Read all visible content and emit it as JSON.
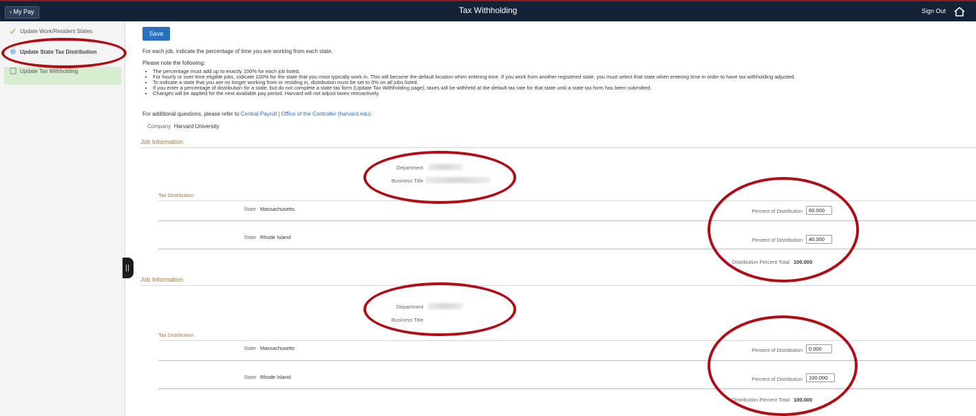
{
  "header": {
    "back_label": "My Pay",
    "title": "Tax Withholding",
    "sign_out": "Sign Out",
    "home_icon": "home-icon"
  },
  "sidebar": {
    "items": [
      {
        "label": "Update Work/Resident States",
        "icon": "pencil-check-icon"
      },
      {
        "label": "Update State Tax Distribution",
        "icon": "percent-icon",
        "active": true
      },
      {
        "label": "Update Tax Withholding",
        "icon": "form-icon"
      }
    ]
  },
  "toolbar": {
    "save_label": "Save"
  },
  "intro": {
    "instruction": "For each job, indicate the percentage of time you are working from each state.",
    "note_heading": "Please note the following:",
    "notes": [
      "The percentage must add up to exactly 100% for each job listed.",
      "For hourly or over-time eligible jobs, indicate 100% for the state that you most typically work in. This will become the default location when entering time. If you work from another registered state, you must select that state when entering time in order to have tax withholding adjusted.",
      "To indicate a state that you are no longer working from or residing in, distribution must be set to 0% on all jobs listed.",
      "If you enter a percentage of distribution for a state, but do not complete a state tax form (Update Tax Withholding page), taxes will be withheld at the default tax rate for that state until a state tax form has been submitted.",
      "Changes will be applied for the next available pay period. Harvard will not adjust taxes retroactively."
    ],
    "additional_prefix": "For additional questions, please refer to",
    "additional_link": "Central Payroll | Office of the Controller (harvard.edu).",
    "company_label": "Company",
    "company_value": "Harvard University"
  },
  "labels": {
    "job_information": "Job Information",
    "department": "Department",
    "business_title": "Business Title",
    "tax_distribution": "Tax Distribution",
    "state": "State",
    "percent_of_distribution": "Percent of Distribution",
    "distribution_percent_total": "Distribution Percent Total"
  },
  "jobs": [
    {
      "rows": [
        {
          "state": "Massachusetts",
          "percent": "60.000"
        },
        {
          "state": "Rhode Island",
          "percent": "40.000"
        }
      ],
      "total": "100.000"
    },
    {
      "rows": [
        {
          "state": "Massachusetts",
          "percent": "0.000"
        },
        {
          "state": "Rhode Island",
          "percent": "100.000"
        }
      ],
      "total": "100.000"
    }
  ],
  "colors": {
    "header_bg": "#142237",
    "accent_red": "#b00d14",
    "save_blue": "#2b6fbf",
    "section_tan": "#a0784a",
    "sidebar_active": "#d6eecf"
  }
}
